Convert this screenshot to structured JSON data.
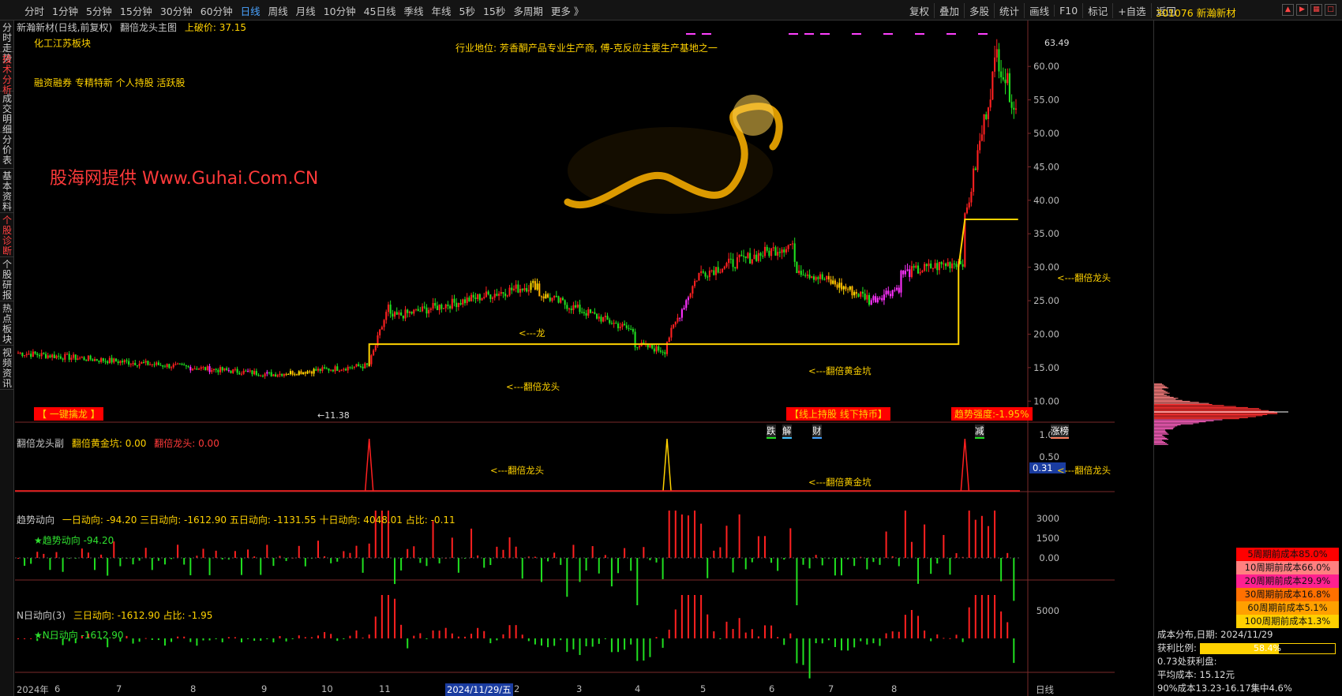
{
  "topbar": {
    "periods": [
      "分时",
      "1分钟",
      "5分钟",
      "15分钟",
      "30分钟",
      "60分钟",
      "日线",
      "周线",
      "月线",
      "10分钟",
      "45日线",
      "季线",
      "年线",
      "5秒",
      "15秒",
      "多周期",
      "更多 》"
    ],
    "active_period": "日线",
    "tools": [
      "复权",
      "叠加",
      "多股",
      "统计",
      "画线",
      "F10",
      "标记",
      "+自选",
      "返回"
    ],
    "stock_title": "301076 新瀚新材"
  },
  "sidetabs": [
    "分时走势",
    "技术分析",
    "成交明细",
    "分价表",
    "基本资料",
    "个股诊断",
    "个股研报",
    "热点板块",
    "视频资讯"
  ],
  "sidetab_active": [
    "技术分析",
    "个股诊断"
  ],
  "main": {
    "header": "新瀚新材(日线,前复权)",
    "indicator": "翻倍龙头主图",
    "breakout_label": "上破价: 37.15",
    "sector": "化工江苏板块",
    "tags": "融资融券 专精特新 个人持股 活跃股",
    "industry": "行业地位: 芳香酮产品专业生产商, 傅-克反应主要生产基地之一",
    "watermark": "股海网提供 Www.Guhai.Com.CN",
    "one_key_button": "【 一键擒龙 】",
    "line_hold": "【线上持股 线下持币】",
    "trend_strength": "趋势强度:-1.95%",
    "low_marker": "←11.38",
    "high_marker": "63.49",
    "dragon_label_1": "<---翻倍龙头",
    "dragon_label_2": "<---龙",
    "gold_pit_label": "<---翻倍黄金坑",
    "dragon_label_3": "<---翻倍龙头",
    "event_tags": [
      "跌",
      "解",
      "财",
      "减",
      "涨榜"
    ],
    "y_ticks": [
      "60.00",
      "55.00",
      "50.00",
      "45.00",
      "40.00",
      "35.00",
      "30.00",
      "25.00",
      "20.00",
      "15.00",
      "10.00"
    ]
  },
  "sub1": {
    "title": "翻倍龙头副",
    "gold_pit": "翻倍黄金坑: 0.00",
    "dragon": "翻倍龙头: 0.00",
    "labels": [
      "<---翻倍龙头",
      "<---翻倍黄金坑",
      "<---翻倍龙头"
    ],
    "y_ticks": [
      "1.00",
      "0.50"
    ],
    "current_value": "0.31"
  },
  "sub2": {
    "title": "趋势动向",
    "values": "一日动向: -94.20  三日动向: -1612.90  五日动向: -1131.55  十日动向: 4048.01  占比: -0.11",
    "star_label": "★趋势动向 -94.20",
    "y_ticks": [
      "3000",
      "1500",
      "0.00"
    ]
  },
  "sub3": {
    "title": "N日动向(3)",
    "values": "三日动向: -1612.90  占比: -1.95",
    "star_label": "★N日动向 -1612.90",
    "y_ticks": [
      "5000"
    ]
  },
  "xaxis": {
    "labels": [
      "2024年",
      "6",
      "7",
      "8",
      "9",
      "10",
      "11",
      "2024/11/29/五",
      "2",
      "3",
      "4",
      "5",
      "6",
      "7",
      "8"
    ],
    "period": "日线"
  },
  "chart_data": {
    "type": "candlestick",
    "title": "新瀚新材(日线,前复权)",
    "ylim": [
      8.5,
      64.5
    ],
    "low": 11.38,
    "high": 63.49,
    "breakout_price": 37.15,
    "support_line": 18.5,
    "segments": [
      {
        "from": 0,
        "to": 120,
        "start": 17.2,
        "end": 14.0
      },
      {
        "from": 120,
        "to": 165,
        "start": 14.0,
        "end": 15.3
      },
      {
        "from": 165,
        "to": 175,
        "start": 15.5,
        "end": 24.0
      },
      {
        "from": 175,
        "to": 245,
        "start": 22.5,
        "end": 27.5
      },
      {
        "from": 245,
        "to": 290,
        "start": 26.0,
        "end": 20.5
      },
      {
        "from": 290,
        "to": 305,
        "start": 18.5,
        "end": 17.5
      },
      {
        "from": 305,
        "to": 320,
        "start": 19.0,
        "end": 28.5
      },
      {
        "from": 320,
        "to": 365,
        "start": 29.0,
        "end": 33.5
      },
      {
        "from": 365,
        "to": 400,
        "start": 30.0,
        "end": 25.5
      },
      {
        "from": 400,
        "to": 415,
        "start": 25.0,
        "end": 27.0
      },
      {
        "from": 415,
        "to": 445,
        "start": 29.0,
        "end": 31.0
      },
      {
        "from": 445,
        "to": 460,
        "start": 37.0,
        "end": 60.0
      },
      {
        "from": 460,
        "to": 470,
        "start": 62.0,
        "end": 53.5
      }
    ]
  },
  "right_panel": {
    "legend": [
      {
        "label": "5周期前成本85.0%",
        "color": "#ff0000"
      },
      {
        "label": "10周期前成本66.0%",
        "color": "#ff8080"
      },
      {
        "label": "20周期前成本29.9%",
        "color": "#ff2090"
      },
      {
        "label": "30周期前成本16.8%",
        "color": "#ff7000"
      },
      {
        "label": "60周期前成本5.1%",
        "color": "#ffa000"
      },
      {
        "label": "100周期前成本1.3%",
        "color": "#ffd000"
      }
    ],
    "cost_date": "成本分布,日期: 2024/11/29",
    "profit_ratio_label": "获利比例:",
    "profit_ratio": "58.4%",
    "profit_ratio_value": 0.584,
    "profit_point": "0.73处获利盘:",
    "avg_cost": "平均成本: 15.12元",
    "concentration": "90%成本13.23-16.17集中4.6%"
  }
}
